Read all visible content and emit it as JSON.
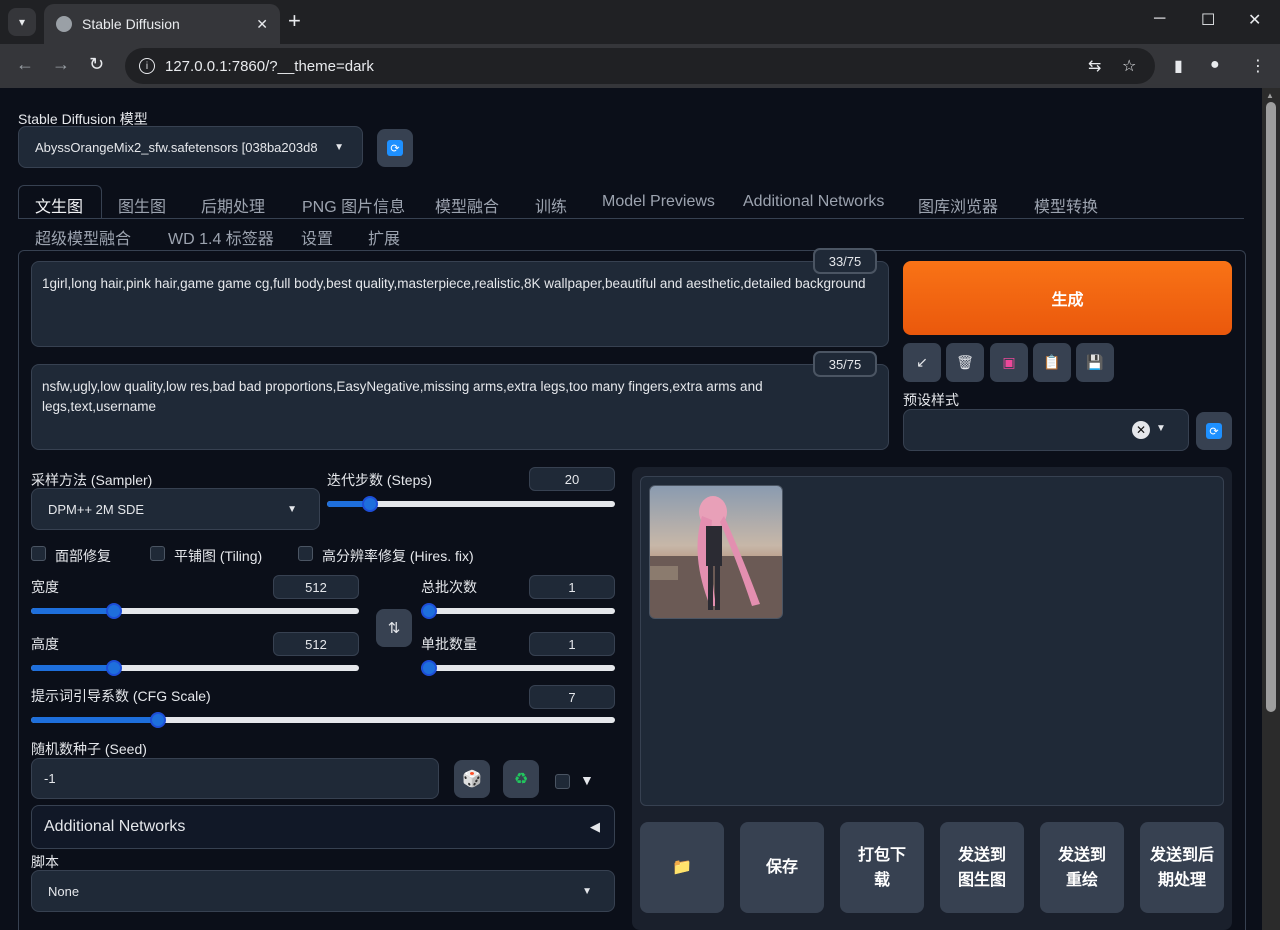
{
  "browser": {
    "tab_title": "Stable Diffusion",
    "url": "127.0.0.1:7860/?__theme=dark"
  },
  "model": {
    "label": "Stable Diffusion 模型",
    "selected": "AbyssOrangeMix2_sfw.safetensors [038ba203d8"
  },
  "tabs_row1": [
    "文生图",
    "图生图",
    "后期处理",
    "PNG 图片信息",
    "模型融合",
    "训练",
    "Model Previews",
    "Additional Networks",
    "图库浏览器",
    "模型转换"
  ],
  "tabs_row2": [
    "超级模型融合",
    "WD 1.4 标签器",
    "设置",
    "扩展"
  ],
  "active_tab": "文生图",
  "prompt": {
    "positive": "1girl,long hair,pink hair,game game cg,full body,best quality,masterpiece,realistic,8K wallpaper,beautiful and aesthetic,detailed background",
    "positive_count": "33/75",
    "negative": "nsfw,ugly,low quality,low res,bad bad proportions,EasyNegative,missing arms,extra legs,too many fingers,extra arms and legs,text,username",
    "negative_count": "35/75"
  },
  "generate_label": "生成",
  "styles_label": "预设样式",
  "sampler": {
    "label": "采样方法 (Sampler)",
    "value": "DPM++ 2M SDE"
  },
  "steps": {
    "label": "迭代步数 (Steps)",
    "value": "20",
    "fraction": 0.13
  },
  "checkboxes": {
    "restore_faces": "面部修复",
    "tiling": "平铺图 (Tiling)",
    "hires": "高分辨率修复 (Hires. fix)"
  },
  "width": {
    "label": "宽度",
    "value": "512",
    "fraction": 0.24
  },
  "height": {
    "label": "高度",
    "value": "512",
    "fraction": 0.24
  },
  "batch_count": {
    "label": "总批次数",
    "value": "1",
    "fraction": 0.0
  },
  "batch_size": {
    "label": "单批数量",
    "value": "1",
    "fraction": 0.0
  },
  "cfg": {
    "label": "提示词引导系数 (CFG Scale)",
    "value": "7",
    "fraction": 0.21
  },
  "seed": {
    "label": "随机数种子 (Seed)",
    "value": "-1"
  },
  "additional_networks": "Additional Networks",
  "script": {
    "label": "脚本",
    "value": "None"
  },
  "actions": {
    "save": "保存",
    "zip": "打包下载",
    "to_img2img": "发送到图生图",
    "to_inpaint": "发送到重绘",
    "to_extras": "发送到后期处理"
  },
  "colors": {
    "accent": "#f97316",
    "slider": "#1e6fdc",
    "bg": "#0b0f19"
  }
}
